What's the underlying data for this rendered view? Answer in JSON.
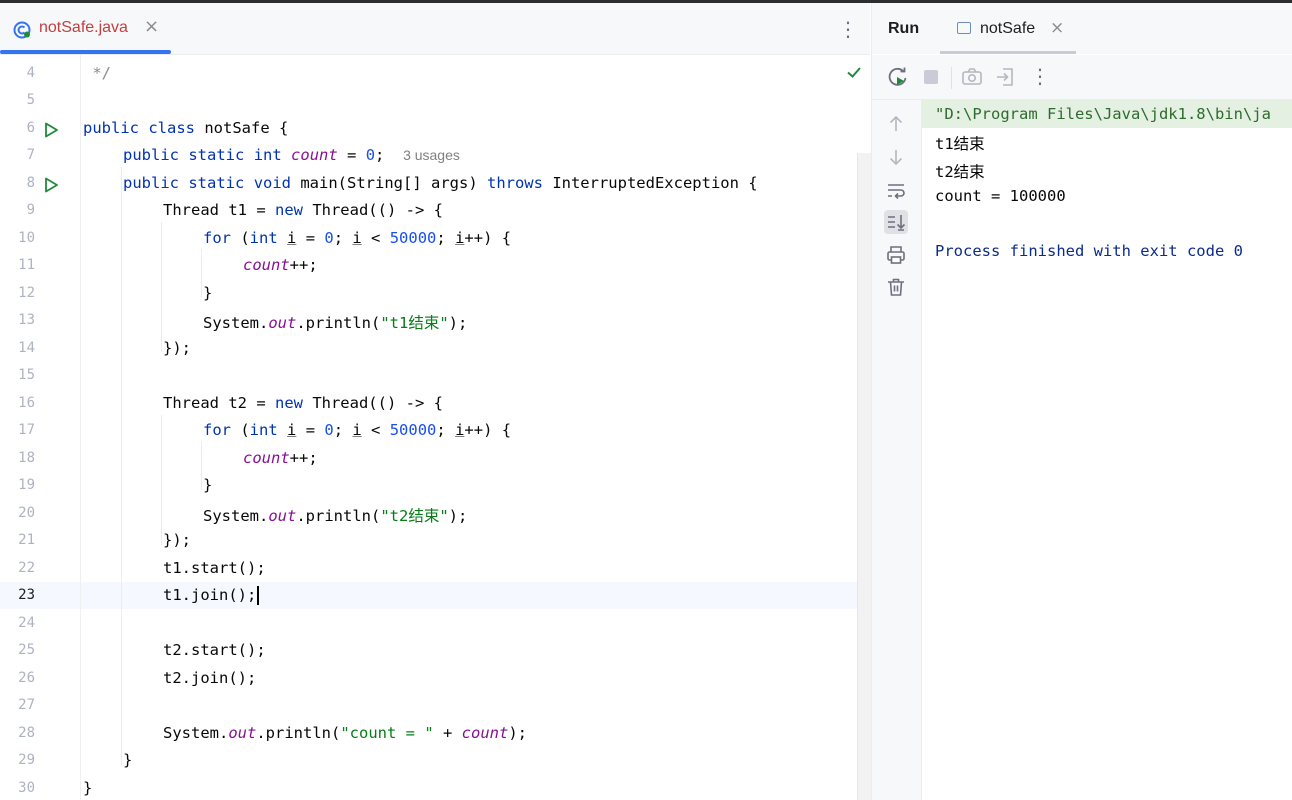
{
  "editor": {
    "tab": {
      "filename": "notSafe.java",
      "close": "×"
    },
    "more_menu": "⋮",
    "current_line": "23",
    "lines": [
      {
        "num": "4"
      },
      {
        "num": "5"
      },
      {
        "num": "6"
      },
      {
        "num": "7"
      },
      {
        "num": "8"
      },
      {
        "num": "9"
      },
      {
        "num": "10"
      },
      {
        "num": "11"
      },
      {
        "num": "12"
      },
      {
        "num": "13"
      },
      {
        "num": "14"
      },
      {
        "num": "15"
      },
      {
        "num": "16"
      },
      {
        "num": "17"
      },
      {
        "num": "18"
      },
      {
        "num": "19"
      },
      {
        "num": "20"
      },
      {
        "num": "21"
      },
      {
        "num": "22"
      },
      {
        "num": "23"
      },
      {
        "num": "24"
      },
      {
        "num": "25"
      },
      {
        "num": "26"
      },
      {
        "num": "27"
      },
      {
        "num": "28"
      },
      {
        "num": "29"
      },
      {
        "num": "30"
      }
    ],
    "code": {
      "l4": " */",
      "l6_public": "public",
      "l6_class": "class",
      "l6_name": " notSafe {",
      "l7_public": "public",
      "l7_static": "static",
      "l7_int": "int",
      "l7_count": "count",
      "l7_eq": " = ",
      "l7_zero": "0",
      "l7_end": ";",
      "l7_hint": "3 usages",
      "l8_public": "public",
      "l8_static": "static",
      "l8_void": "void",
      "l8_main": " main(String[] args) ",
      "l8_throws": "throws",
      "l8_rest": " InterruptedException {",
      "l9_a": "Thread t1 = ",
      "l9_new": "new",
      "l9_b": " Thread(() -> {",
      "l10_for": "for",
      "l10_a": " (",
      "l10_int": "int",
      "l10_i1": "i",
      "l10_b": " = ",
      "l10_zero": "0",
      "l10_c": "; ",
      "l10_i2": "i",
      "l10_d": " < ",
      "l10_num": "50000",
      "l10_e": "; ",
      "l10_i3": "i",
      "l10_f": "++) {",
      "l11_count": "count",
      "l11_end": "++;",
      "l12": "}",
      "l13_a": "System.",
      "l13_out": "out",
      "l13_b": ".println(",
      "l13_str": "\"t1结束\"",
      "l13_c": ");",
      "l14": "});",
      "l16_a": "Thread t2 = ",
      "l16_new": "new",
      "l16_b": " Thread(() -> {",
      "l17_for": "for",
      "l17_a": " (",
      "l17_int": "int",
      "l17_i1": "i",
      "l17_b": " = ",
      "l17_zero": "0",
      "l17_c": "; ",
      "l17_i2": "i",
      "l17_d": " < ",
      "l17_num": "50000",
      "l17_e": "; ",
      "l17_i3": "i",
      "l17_f": "++) {",
      "l18_count": "count",
      "l18_end": "++;",
      "l19": "}",
      "l20_a": "System.",
      "l20_out": "out",
      "l20_b": ".println(",
      "l20_str": "\"t2结束\"",
      "l20_c": ");",
      "l21": "});",
      "l22": "t1.start();",
      "l23": "t1.join();",
      "l25": "t2.start();",
      "l26": "t2.join();",
      "l28_a": "System.",
      "l28_out": "out",
      "l28_b": ".println(",
      "l28_str": "\"count = \"",
      "l28_c": " + ",
      "l28_count": "count",
      "l28_d": ");",
      "l29": "}",
      "l30": "}"
    }
  },
  "run_panel": {
    "title": "Run",
    "tab": {
      "label": "notSafe",
      "close": "×"
    },
    "toolbar_more": "⋮",
    "console": {
      "command": "\"D:\\Program Files\\Java\\jdk1.8\\bin\\ja",
      "out1": "t1结束",
      "out2": "t2结束",
      "out3": "count = 100000",
      "exit": "Process finished with exit code 0"
    }
  },
  "colors": {
    "keyword": "#0033b3",
    "string": "#067d17",
    "number": "#1750eb",
    "static_field": "#871094",
    "tab_active": "#c43e3e",
    "accent": "#3574f0",
    "run_green": "#208a3c"
  }
}
